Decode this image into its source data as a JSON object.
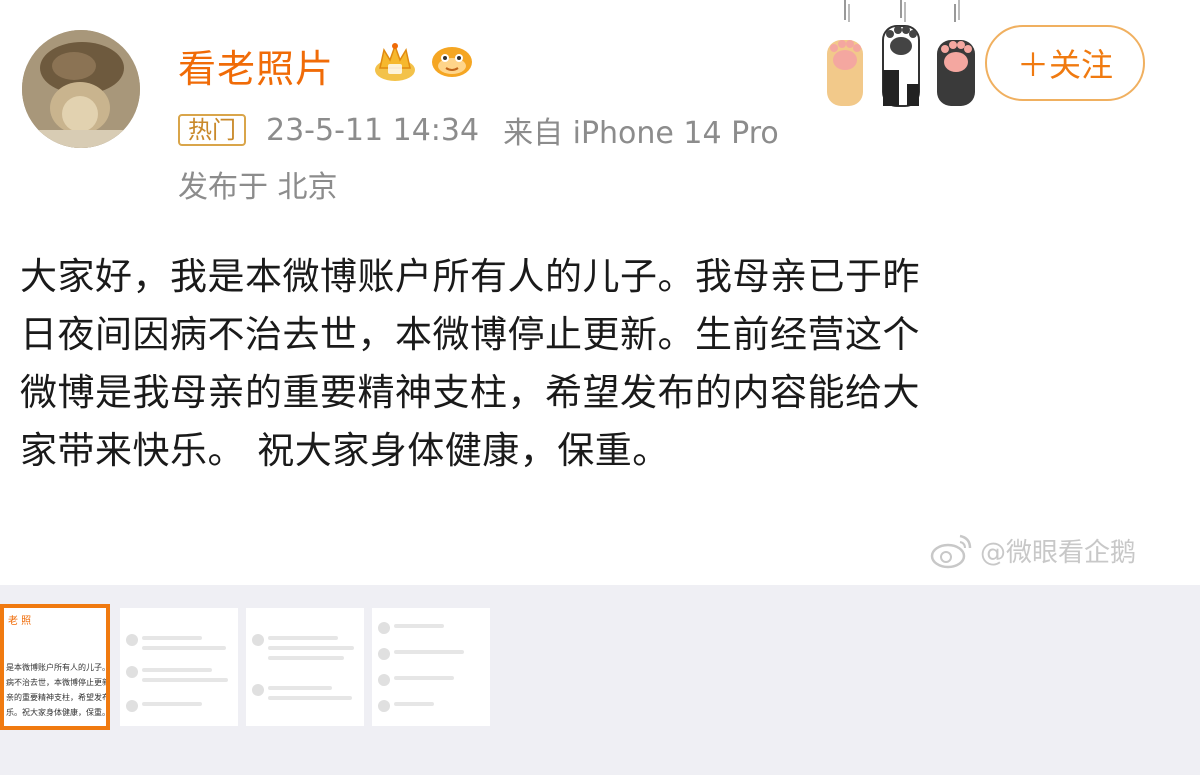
{
  "post": {
    "username": "看老照片",
    "hot_badge": "热门",
    "timestamp": "23-5-11 14:34",
    "source": "来自 iPhone 14 Pro",
    "location": "发布于 北京",
    "follow_label": "＋关注",
    "body_lines": [
      "大家好，我是本微博账户所有人的儿子。我母亲已于昨",
      "日夜间因病不治去世，本微博停止更新。生前经营这个",
      "微博是我母亲的重要精神支柱，希望发布的内容能给大",
      "家带来快乐。 祝大家身体健康，保重。"
    ],
    "watermark": "@微眼看企鹅"
  },
  "thumbnail_strip": {
    "active_thumb_text": [
      "老 照",
      "",
      "是本微博账户所有人的儿子。",
      "病不治去世，本微博停止更新。",
      "亲的重要精神支柱，希望发布",
      "乐。祝大家身体健康，保重。"
    ]
  },
  "colors": {
    "username": "#f06b07",
    "accent": "#f07a10",
    "meta_gray": "#8c8c8c",
    "background": "#efeff4"
  },
  "icons": [
    "crown-badge-icon",
    "fish-badge-icon",
    "cat-paw-icon",
    "weibo-logo-icon"
  ]
}
